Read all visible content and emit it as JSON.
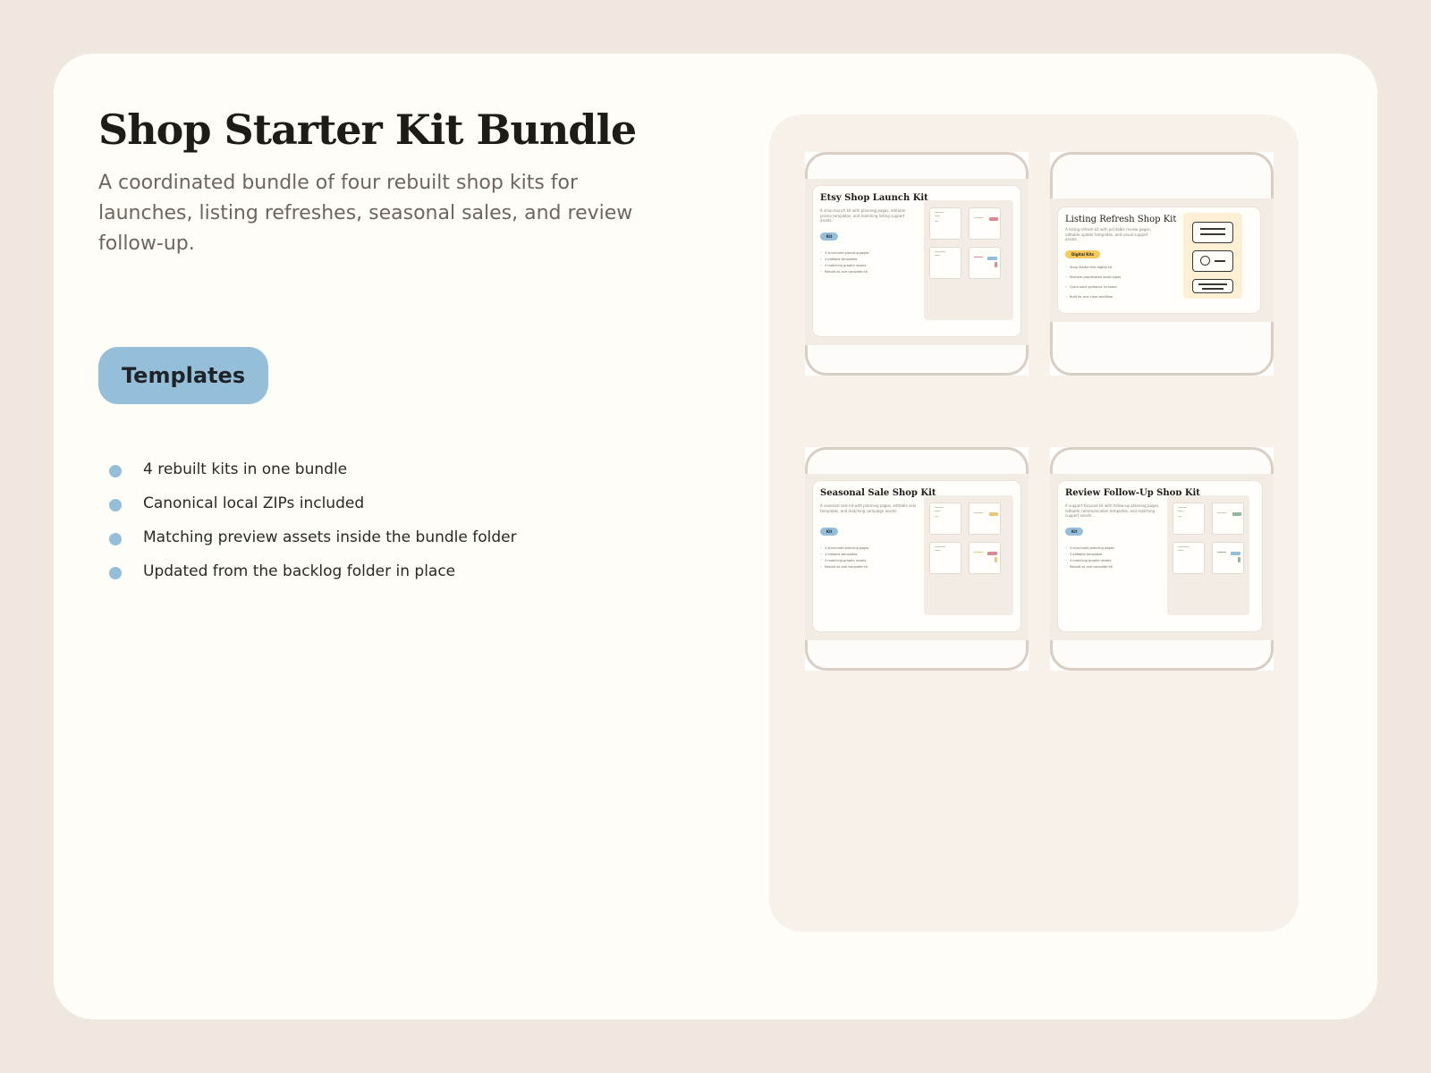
{
  "header": {
    "title": "Shop Starter Kit Bundle",
    "subtitle": "A coordinated bundle of four rebuilt shop kits for launches, listing refreshes, seasonal sales, and review follow-up."
  },
  "tag": {
    "label": "Templates"
  },
  "features": [
    "4 rebuilt kits in one bundle",
    "Canonical local ZIPs included",
    "Matching preview assets inside the bundle folder",
    "Updated from the backlog folder in place"
  ],
  "kits": [
    {
      "title": "Etsy Shop Launch Kit",
      "description": "A shop-launch kit with planning pages, editable promo templates, and matching listing support assets.",
      "chip": "Kit",
      "items": [
        "4 structured planning pages",
        "4 editable templates",
        "4 matching graphic assets",
        "Rebuilt as one complete kit"
      ],
      "accent": "#d98a96"
    },
    {
      "title": "Listing Refresh Shop Kit",
      "description": "A listing-refresh kit with printable review pages, editable update templates, and visual support assets.",
      "chip": "Digital Kits",
      "items": [
        "Shop Starter Kits digital kit",
        "Multiple coordinated asset types",
        "Quick-start guidance included",
        "Built for one clear workflow"
      ],
      "accent": "#f7c95a"
    },
    {
      "title": "Seasonal Sale Shop Kit",
      "description": "A seasonal sale kit with planning pages, editable sale templates, and matching campaign assets.",
      "chip": "Kit",
      "items": [
        "4 structured planning pages",
        "4 editable templates",
        "4 matching graphic assets",
        "Rebuilt as one complete kit"
      ],
      "accent": "#e8c77a"
    },
    {
      "title": "Review Follow-Up Shop Kit",
      "description": "A support-focused kit with follow-up planning pages, editable communication templates, and matching support assets.",
      "chip": "Kit",
      "items": [
        "4 structured planning pages",
        "4 editable templates",
        "4 matching graphic assets",
        "Rebuilt as one complete kit"
      ],
      "accent": "#8fb79a"
    }
  ],
  "colors": {
    "background": "#f0e8df",
    "card": "#fffdf8",
    "accent_blue": "#95bfd8",
    "accent_yellow": "#f7c95a",
    "title_text": "#1f1c18",
    "muted_text": "#6e655c"
  }
}
